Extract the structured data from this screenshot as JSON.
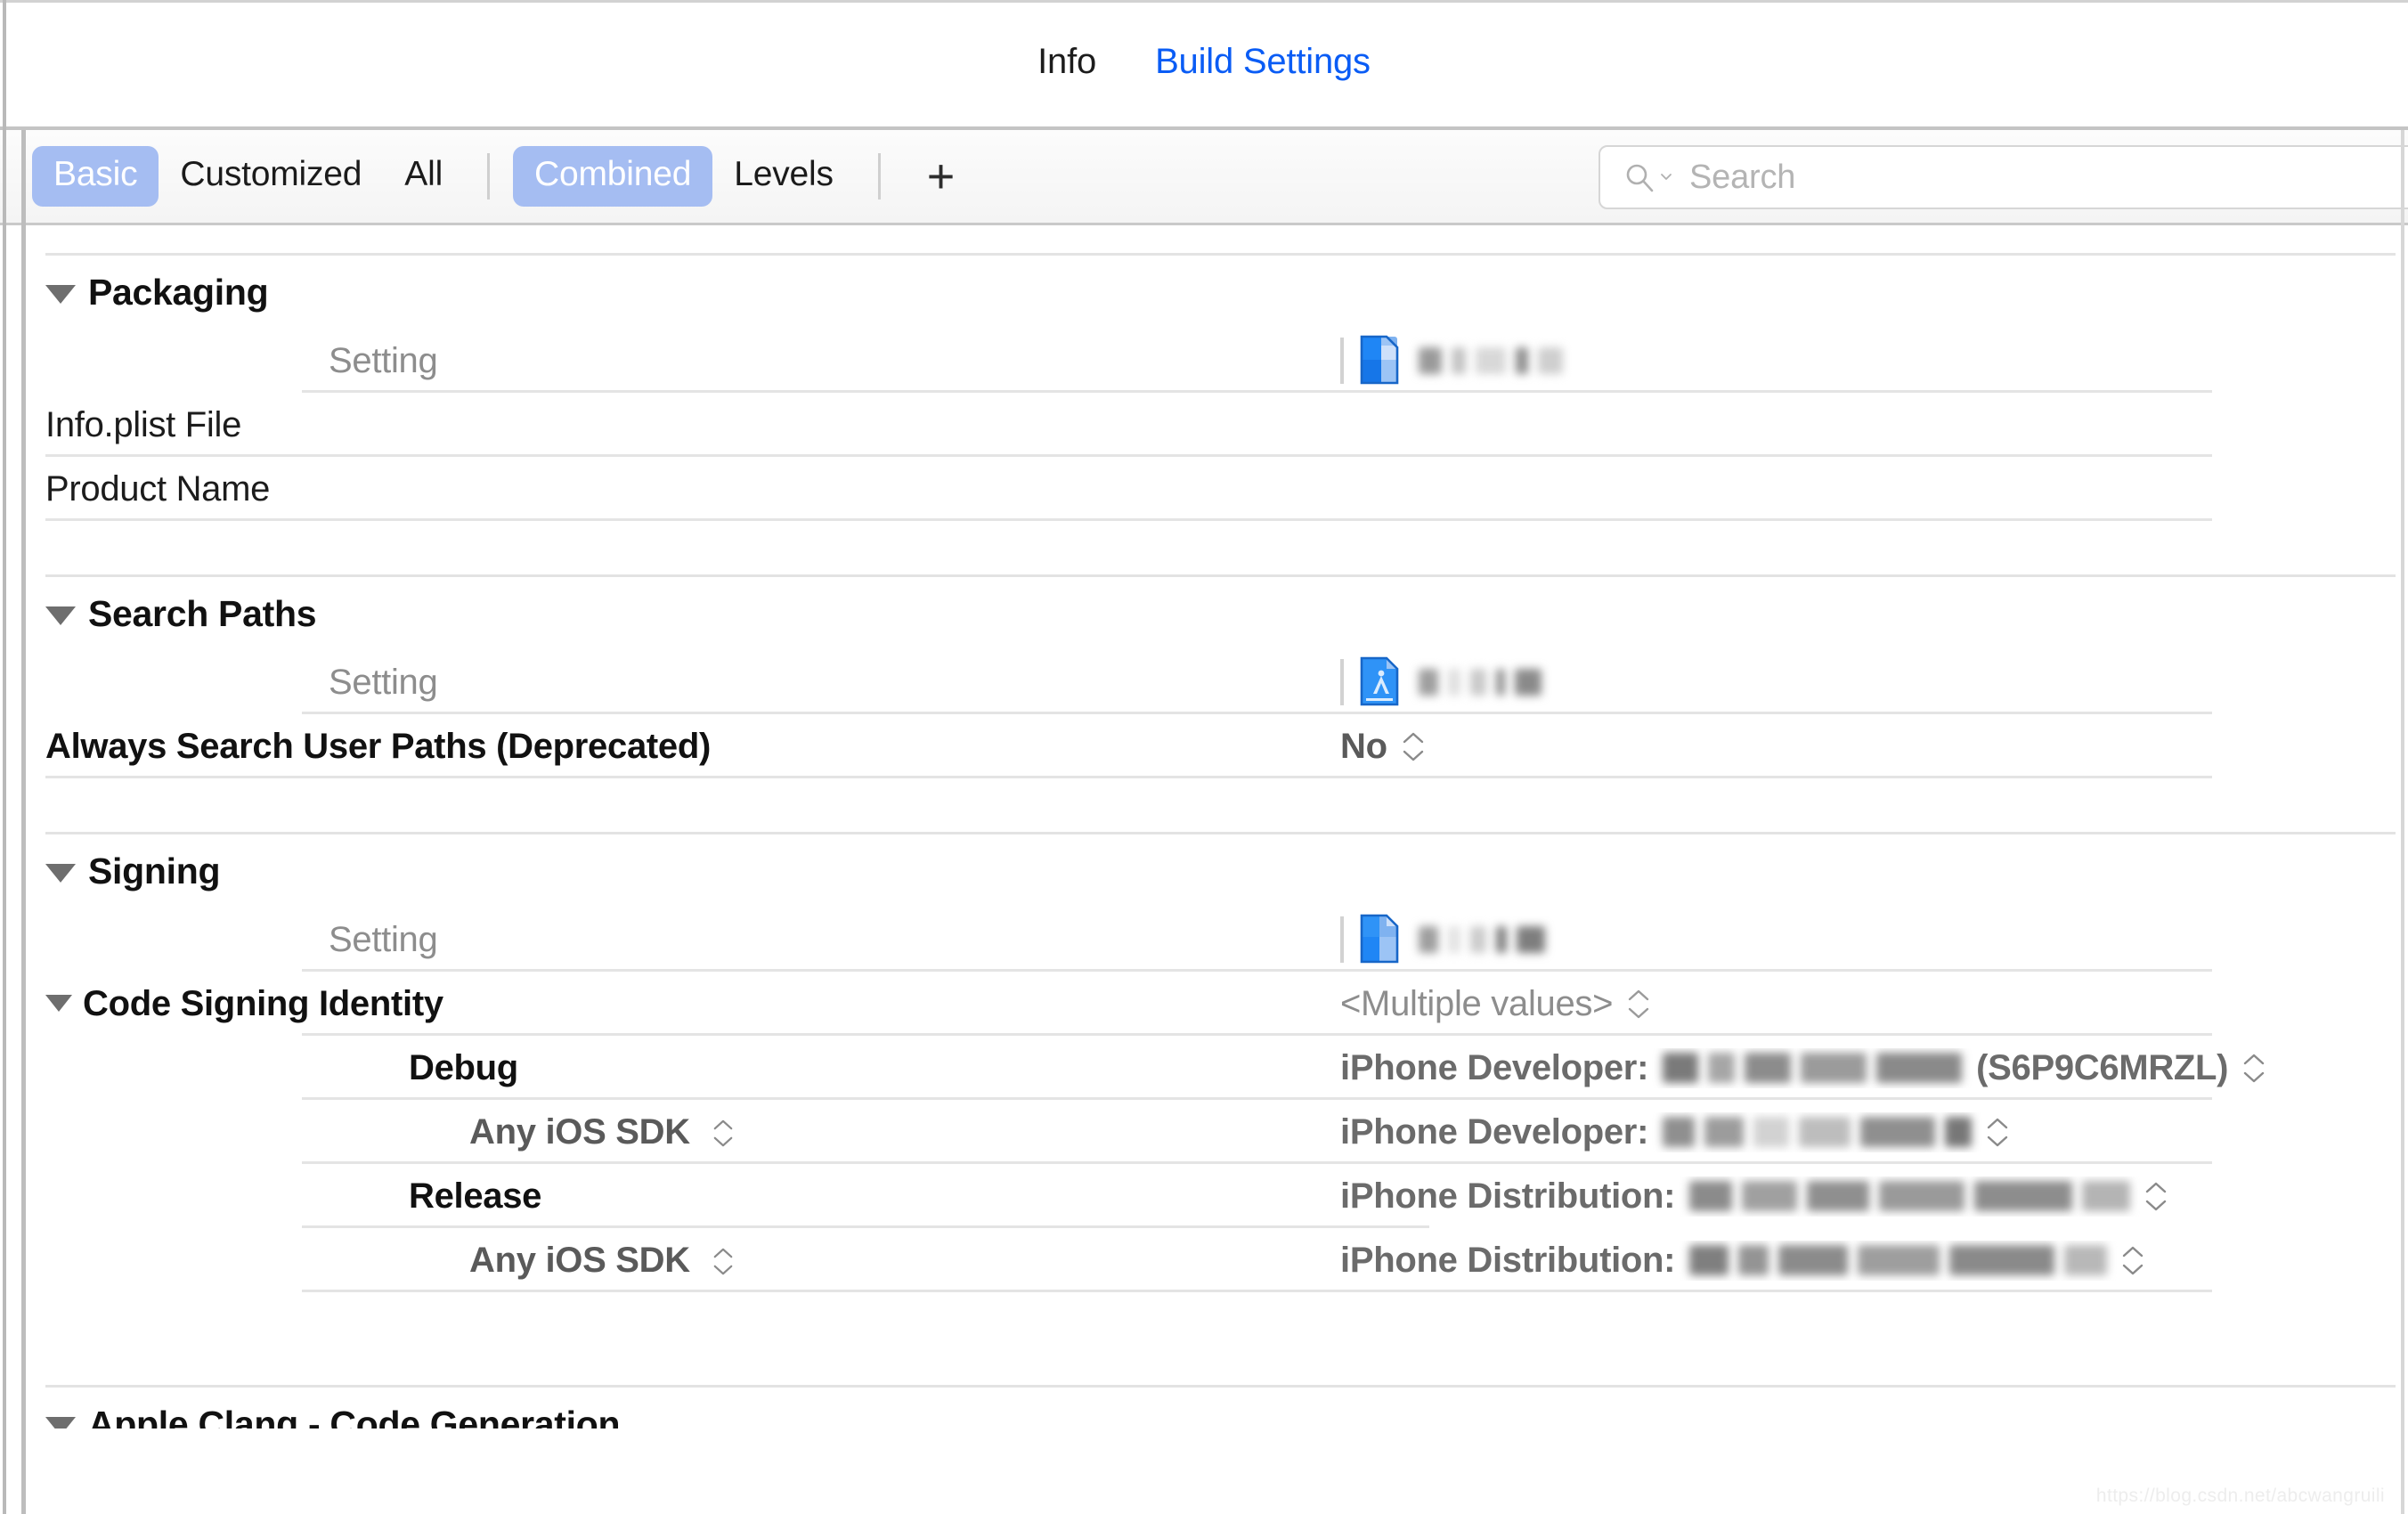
{
  "tabs": [
    {
      "label": "Info",
      "active": false
    },
    {
      "label": "Build Settings",
      "active": true
    }
  ],
  "toolbar": {
    "filters": [
      {
        "label": "Basic",
        "selected": true
      },
      {
        "label": "Customized",
        "selected": false
      },
      {
        "label": "All",
        "selected": false
      }
    ],
    "levels": [
      {
        "label": "Combined",
        "selected": true
      },
      {
        "label": "Levels",
        "selected": false
      }
    ],
    "add_label": "+"
  },
  "search": {
    "placeholder": "Search",
    "value": "",
    "icon": "search-icon"
  },
  "sections": [
    {
      "id": "packaging",
      "title": "Packaging",
      "expanded": true,
      "rows": [
        {
          "kind": "setting-header",
          "name": "Setting",
          "icon": "xcode-project-icon",
          "redacted_value": true
        },
        {
          "kind": "value",
          "name": "Info.plist File",
          "value": ""
        },
        {
          "kind": "value",
          "name": "Product Name",
          "value": ""
        }
      ]
    },
    {
      "id": "search-paths",
      "title": "Search Paths",
      "expanded": true,
      "rows": [
        {
          "kind": "setting-header",
          "name": "Setting",
          "icon": "xcode-target-icon",
          "redacted_value": true
        },
        {
          "kind": "value",
          "name": "Always Search User Paths (Deprecated)",
          "value": "No",
          "stepper": true
        }
      ]
    },
    {
      "id": "signing",
      "title": "Signing",
      "expanded": true,
      "rows": [
        {
          "kind": "setting-header",
          "name": "Setting",
          "icon": "xcode-project-icon",
          "redacted_value": true
        },
        {
          "kind": "group",
          "name": "Code Signing Identity",
          "value": "<Multiple values>",
          "stepper": true,
          "expanded": true
        },
        {
          "kind": "config",
          "name": "Debug",
          "value": "iPhone Developer: ",
          "value_suffix": "(S6P9C6MRZL)",
          "redacted_value": true,
          "stepper": true
        },
        {
          "kind": "sdk",
          "name": "Any iOS SDK",
          "name_stepper": true,
          "value": "iPhone Developer: ",
          "value_suffix": "",
          "redacted_value": true,
          "stepper": true
        },
        {
          "kind": "config",
          "name": "Release",
          "value": "iPhone Distribution: ",
          "value_suffix": "",
          "redacted_value": true,
          "stepper": true
        },
        {
          "kind": "sdk",
          "name": "Any iOS SDK",
          "name_stepper": true,
          "value": "iPhone Distribution: ",
          "value_suffix": "",
          "redacted_value": true,
          "stepper": true
        }
      ]
    },
    {
      "id": "apple-clang-code-generation",
      "title": "Apple Clang - Code Generation",
      "expanded": true,
      "clipped": true,
      "rows": []
    }
  ],
  "watermark": "https://blog.csdn.net/abcwangruili",
  "colors": {
    "accent": "#0a5cf5",
    "segment_selected": "#a5bdf2",
    "text": "#1c1c1c",
    "muted": "#8d8d8d",
    "divider": "#e4e4e4"
  }
}
